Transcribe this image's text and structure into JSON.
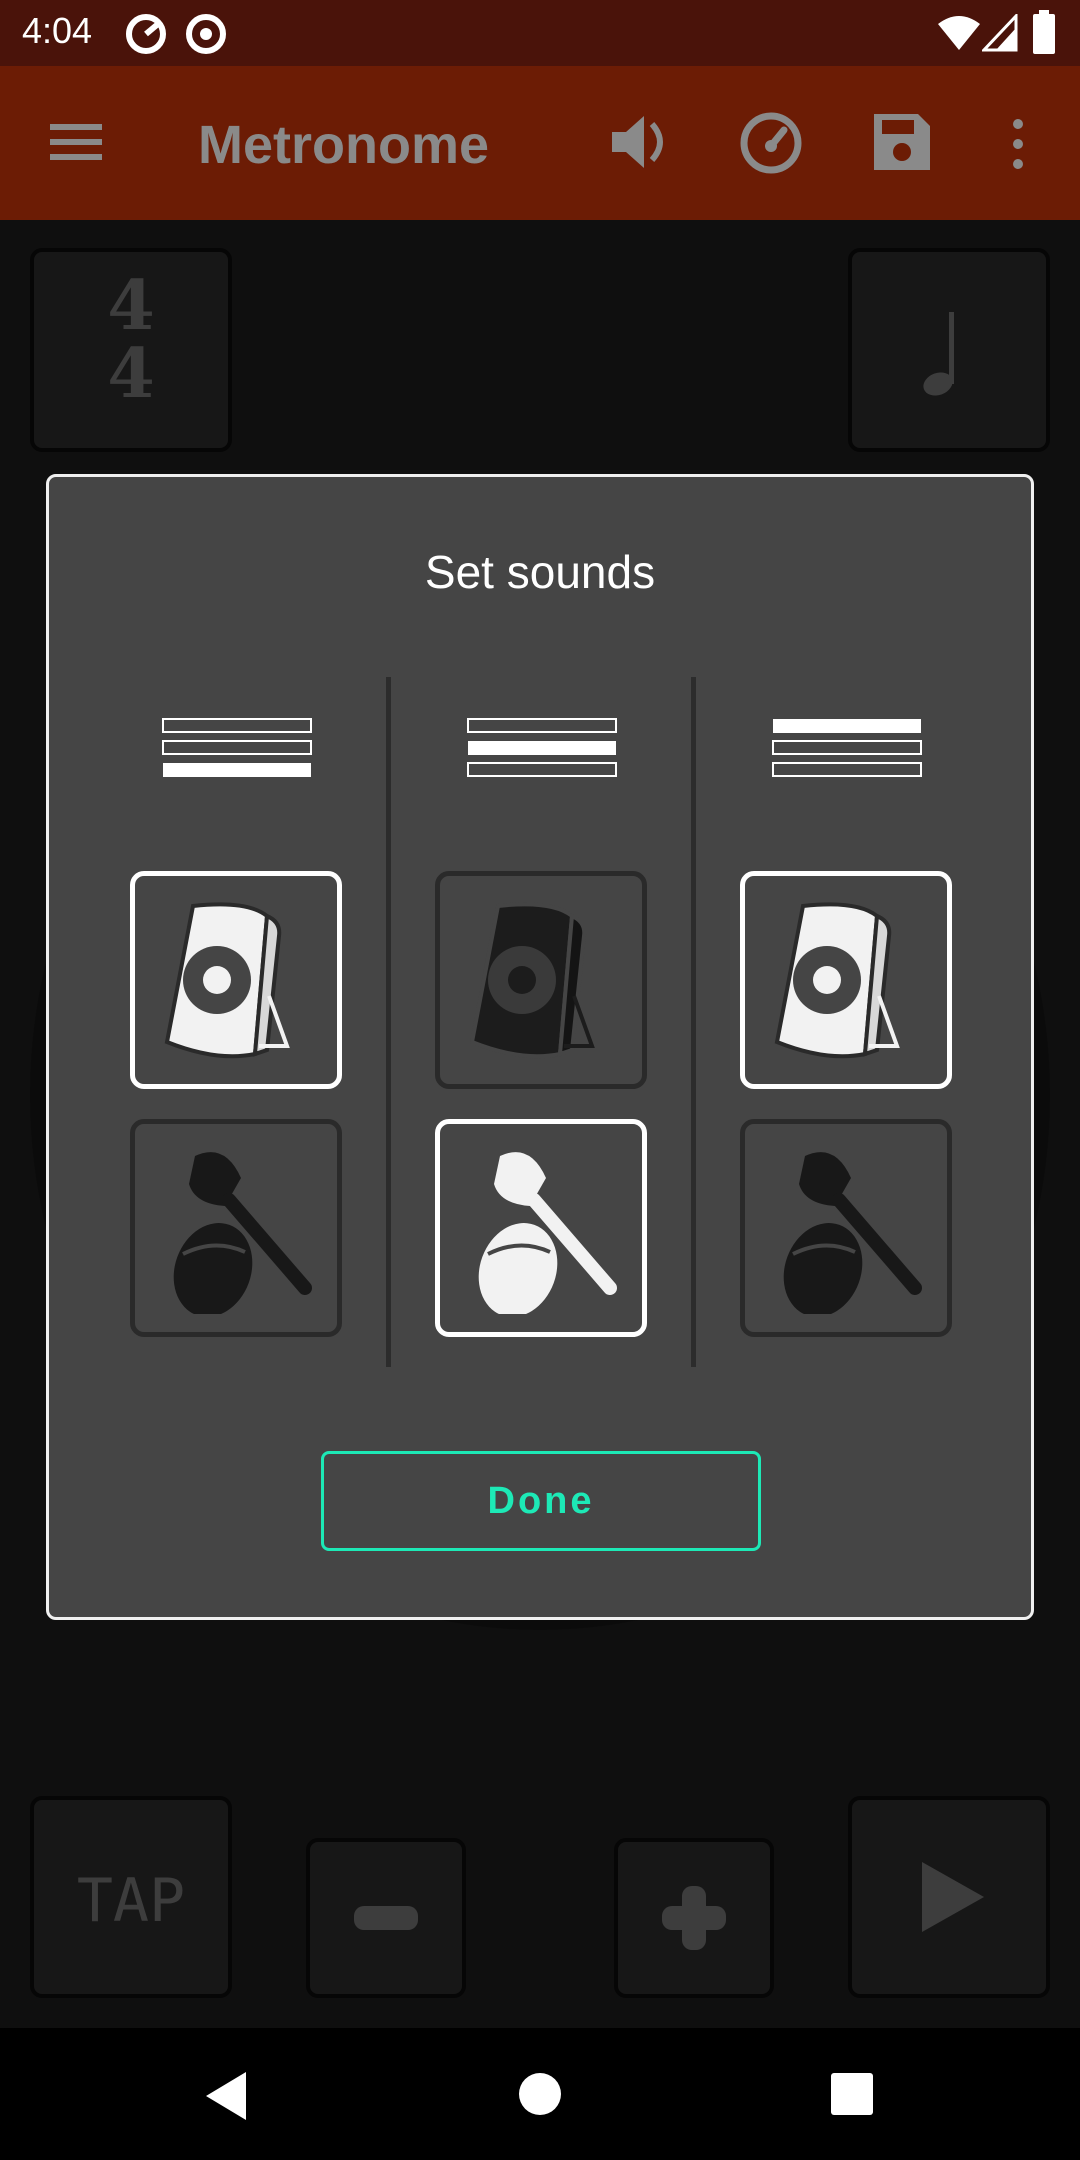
{
  "status_bar": {
    "time": "4:04"
  },
  "app_bar": {
    "title": "Metronome"
  },
  "main": {
    "time_signature_top": "4",
    "time_signature_bottom": "4",
    "tap_label": "TAP"
  },
  "dialog": {
    "title": "Set sounds",
    "done_label": "Done",
    "columns": [
      {
        "level": "low",
        "speaker_selected": true,
        "maracas_selected": false
      },
      {
        "level": "medium",
        "speaker_selected": false,
        "maracas_selected": true
      },
      {
        "level": "high",
        "speaker_selected": true,
        "maracas_selected": false
      }
    ]
  },
  "colors": {
    "accent": "#1de9b6",
    "app_bar": "#6c1c05",
    "status_bar": "#4a130a"
  }
}
